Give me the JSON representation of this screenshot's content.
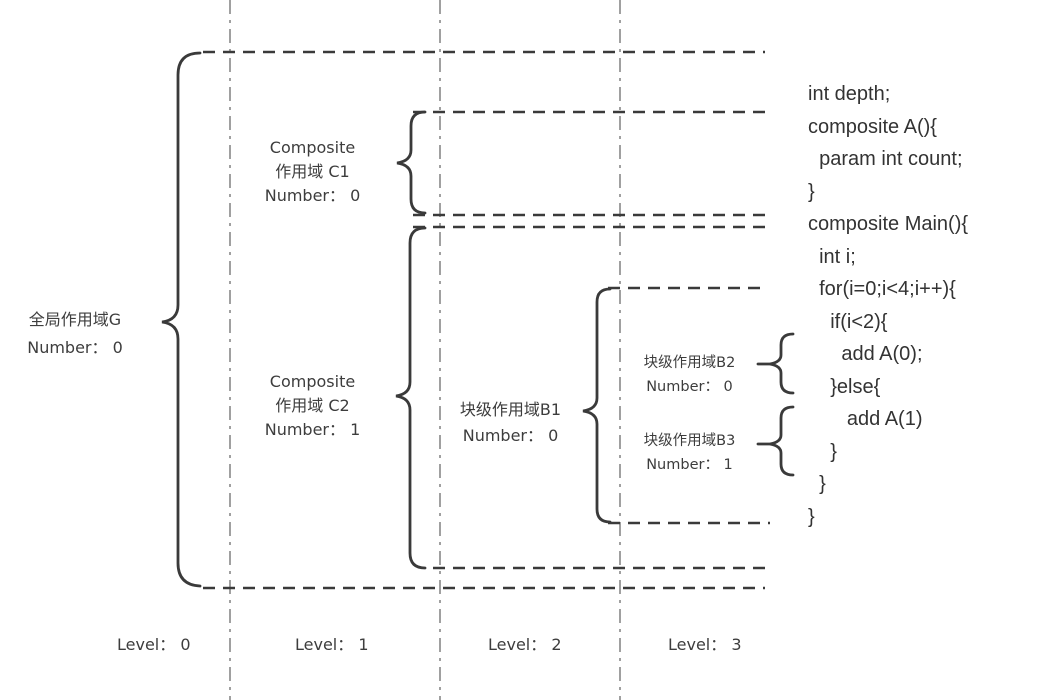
{
  "scopes": {
    "global": {
      "name": "全局作用域G",
      "number": "Number： 0"
    },
    "composite_c1": {
      "line1": "Composite",
      "line2": "作用域 C1",
      "number": "Number： 0"
    },
    "composite_c2": {
      "line1": "Composite",
      "line2": "作用域 C2",
      "number": "Number： 1"
    },
    "block_b1": {
      "name": "块级作用域B1",
      "number": "Number： 0"
    },
    "block_b2": {
      "name": "块级作用域B2",
      "number": "Number： 0"
    },
    "block_b3": {
      "name": "块级作用域B3",
      "number": "Number： 1"
    }
  },
  "levels": [
    "Level： 0",
    "Level： 1",
    "Level： 2",
    "Level： 3"
  ],
  "code_lines": [
    "int depth;",
    "composite A(){",
    "  param int count;",
    "}",
    "composite Main(){",
    "  int i;",
    "  for(i=0;i<4;i++){",
    "    if(i<2){",
    "      add A(0);",
    "    }else{",
    "       add A(1)",
    "    }",
    "  }",
    "}"
  ],
  "colors": {
    "brace": "#3a3a3a",
    "dashed": "#3a3a3a",
    "level_divider": "#9a9a9a",
    "text": "#3d3d3d"
  }
}
